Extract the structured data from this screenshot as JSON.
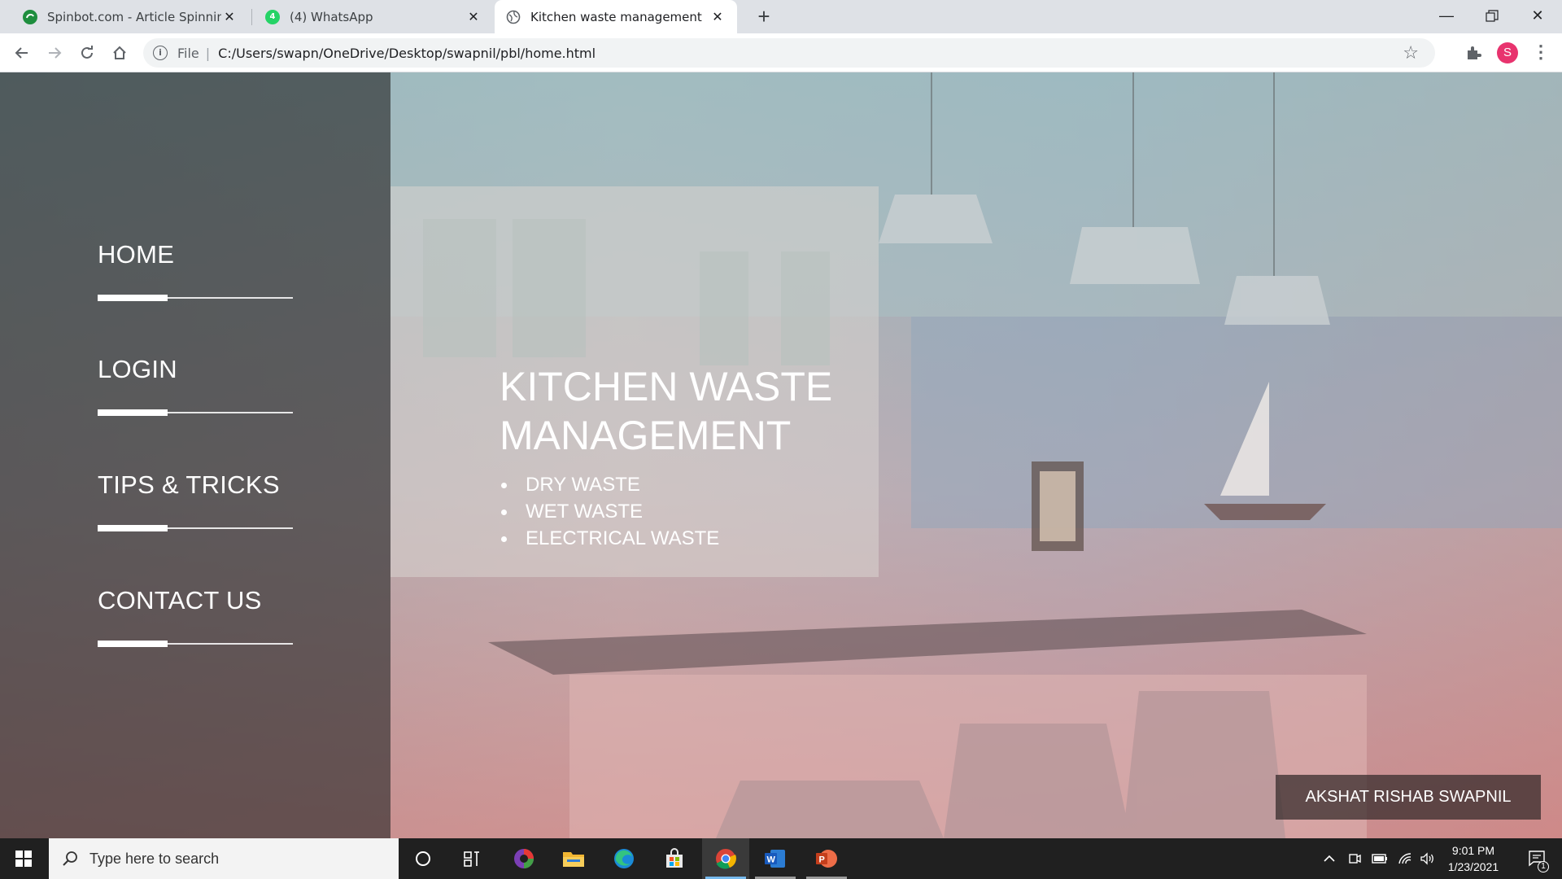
{
  "browser": {
    "tabs": [
      {
        "title": "Spinbot.com - Article Spinning, T",
        "favicon": "spinbot-icon",
        "active": false
      },
      {
        "title": "(4) WhatsApp",
        "favicon": "whatsapp-icon",
        "badge": "4",
        "active": false
      },
      {
        "title": "Kitchen waste management",
        "favicon": "globe-icon",
        "active": true
      }
    ],
    "address": {
      "scheme": "File",
      "url": "C:/Users/swapn/OneDrive/Desktop/swapnil/pbl/home.html"
    },
    "profile_initial": "S",
    "colors": {
      "tabstrip": "#dee1e6",
      "profile": "#e8336e"
    }
  },
  "page": {
    "nav": [
      {
        "label": "HOME"
      },
      {
        "label": "LOGIN"
      },
      {
        "label": "TIPS & TRICKS"
      },
      {
        "label": "CONTACT US"
      }
    ],
    "hero": {
      "title": "KITCHEN WASTE MANAGEMENT",
      "items": [
        "DRY WASTE",
        "WET WASTE",
        "ELECTRICAL WASTE"
      ]
    },
    "credit": "AKSHAT RISHAB SWAPNIL"
  },
  "taskbar": {
    "search_placeholder": "Type here to search",
    "apps": [
      "cortana-icon",
      "task-view-icon",
      "color-app-icon",
      "file-explorer-icon",
      "edge-icon",
      "store-icon",
      "chrome-icon",
      "word-icon",
      "powerpoint-icon"
    ],
    "time": "9:01 PM",
    "date": "1/23/2021",
    "notification_count": "1"
  }
}
